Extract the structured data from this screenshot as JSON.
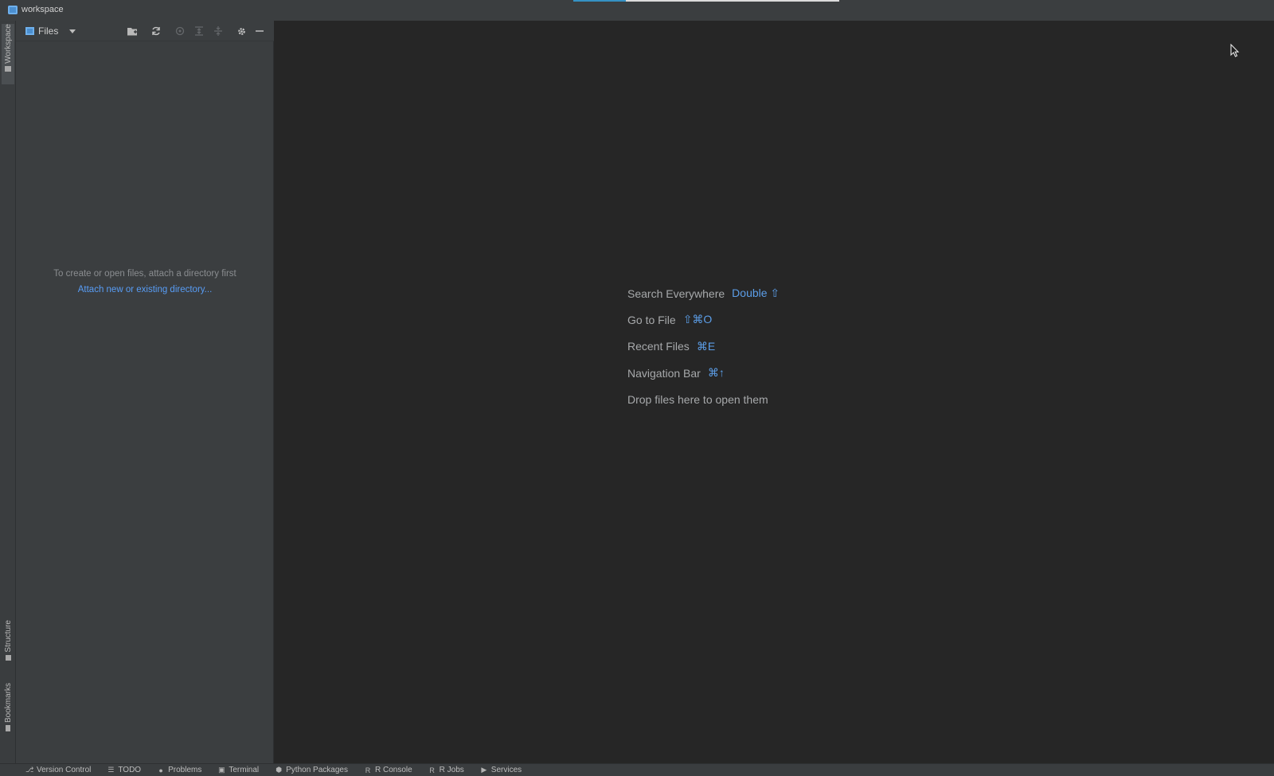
{
  "window": {
    "title": "workspace"
  },
  "left_strip": {
    "tabs": [
      {
        "label": "Workspace",
        "active": true
      },
      {
        "label": "Structure",
        "active": false
      },
      {
        "label": "Bookmarks",
        "active": false
      }
    ]
  },
  "panel": {
    "view_label": "Files",
    "toolbar": {
      "new_directory_icon": "folder-plus-icon",
      "refresh_icon": "sync-icon",
      "locate_icon": "target-icon",
      "expand_icon": "expand-all-icon",
      "collapse_icon": "collapse-all-icon",
      "settings_icon": "gear-icon",
      "hide_icon": "minimize-icon"
    },
    "empty_hint": "To create or open files, attach a directory first",
    "attach_link": "Attach new or existing directory..."
  },
  "editor": {
    "hints": [
      {
        "action": "Search Everywhere",
        "shortcut": "Double ⇧"
      },
      {
        "action": "Go to File",
        "shortcut": "⇧⌘O"
      },
      {
        "action": "Recent Files",
        "shortcut": "⌘E"
      },
      {
        "action": "Navigation Bar",
        "shortcut": "⌘↑"
      },
      {
        "action": "Drop files here to open them",
        "shortcut": ""
      }
    ]
  },
  "bottom_bar": {
    "tabs": [
      {
        "label": "Version Control",
        "icon": "branch-icon"
      },
      {
        "label": "TODO",
        "icon": "list-icon"
      },
      {
        "label": "Problems",
        "icon": "warning-icon"
      },
      {
        "label": "Terminal",
        "icon": "terminal-icon"
      },
      {
        "label": "Python Packages",
        "icon": "layers-icon"
      },
      {
        "label": "R Console",
        "icon": "r-console-icon"
      },
      {
        "label": "R Jobs",
        "icon": "r-jobs-icon"
      },
      {
        "label": "Services",
        "icon": "services-icon"
      }
    ]
  },
  "colors": {
    "accent": "#589df6",
    "shortcut": "#5c9ee8",
    "panel_bg": "#3b3e40",
    "editor_bg": "#262626"
  }
}
